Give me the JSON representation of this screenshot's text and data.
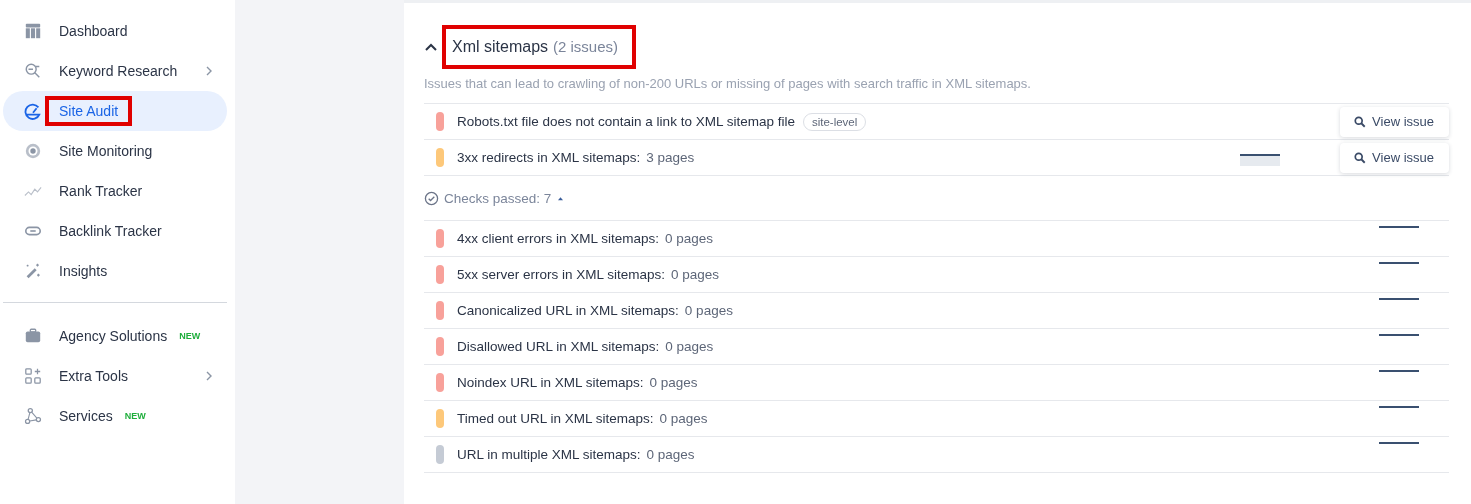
{
  "sidebar": {
    "groups": [
      {
        "items": [
          {
            "label": "Dashboard",
            "selected": false,
            "highlighted": false,
            "has_submenu": false
          },
          {
            "label": "Keyword Research",
            "selected": false,
            "highlighted": false,
            "has_submenu": true
          },
          {
            "label": "Site Audit",
            "selected": true,
            "highlighted": true,
            "has_submenu": false
          },
          {
            "label": "Site Monitoring",
            "selected": false,
            "highlighted": false,
            "has_submenu": false
          },
          {
            "label": "Rank Tracker",
            "selected": false,
            "highlighted": false,
            "has_submenu": false
          },
          {
            "label": "Backlink Tracker",
            "selected": false,
            "highlighted": false,
            "has_submenu": false
          },
          {
            "label": "Insights",
            "selected": false,
            "highlighted": false,
            "has_submenu": false
          }
        ]
      },
      {
        "items": [
          {
            "label": "Agency Solutions",
            "selected": false,
            "highlighted": false,
            "has_submenu": false,
            "badge": "NEW"
          },
          {
            "label": "Extra Tools",
            "selected": false,
            "highlighted": false,
            "has_submenu": true
          },
          {
            "label": "Services",
            "selected": false,
            "highlighted": false,
            "has_submenu": false,
            "badge": "NEW"
          }
        ]
      }
    ]
  },
  "section": {
    "title": "Xml sitemaps",
    "count": "(2 issues)",
    "expanded": true,
    "highlighted": true,
    "description": "Issues that can lead to crawling of non-200 URLs or missing of pages with search traffic in XML sitemaps.",
    "issues": [
      {
        "text": "Robots.txt file does not contain a link to XML sitemap file",
        "color": "#f8a19a",
        "kind": "plain",
        "badge": "site-level",
        "button": "View issue"
      },
      {
        "text": "3xx redirects in XML sitemaps:",
        "pages": "3 pages",
        "color": "#fdc87a",
        "kind": "area",
        "button": "View issue"
      }
    ],
    "checks_passed": {
      "label": "Checks passed: 7",
      "expanded": true
    },
    "passed": [
      {
        "text": "4xx client errors in XML sitemaps:",
        "pages": "0 pages",
        "color": "#f8a19a",
        "kind": "line"
      },
      {
        "text": "5xx server errors in XML sitemaps:",
        "pages": "0 pages",
        "color": "#f8a19a",
        "kind": "line"
      },
      {
        "text": "Canonicalized URL in XML sitemaps:",
        "pages": "0 pages",
        "color": "#f8a19a",
        "kind": "line"
      },
      {
        "text": "Disallowed URL in XML sitemaps:",
        "pages": "0 pages",
        "color": "#f8a19a",
        "kind": "line"
      },
      {
        "text": "Noindex URL in XML sitemaps:",
        "pages": "0 pages",
        "color": "#f8a19a",
        "kind": "line"
      },
      {
        "text": "Timed out URL in XML sitemaps:",
        "pages": "0 pages",
        "color": "#fdc87a",
        "kind": "line"
      },
      {
        "text": "URL in multiple XML sitemaps:",
        "pages": "0 pages",
        "color": "#c5cbd5",
        "kind": "line"
      }
    ]
  }
}
